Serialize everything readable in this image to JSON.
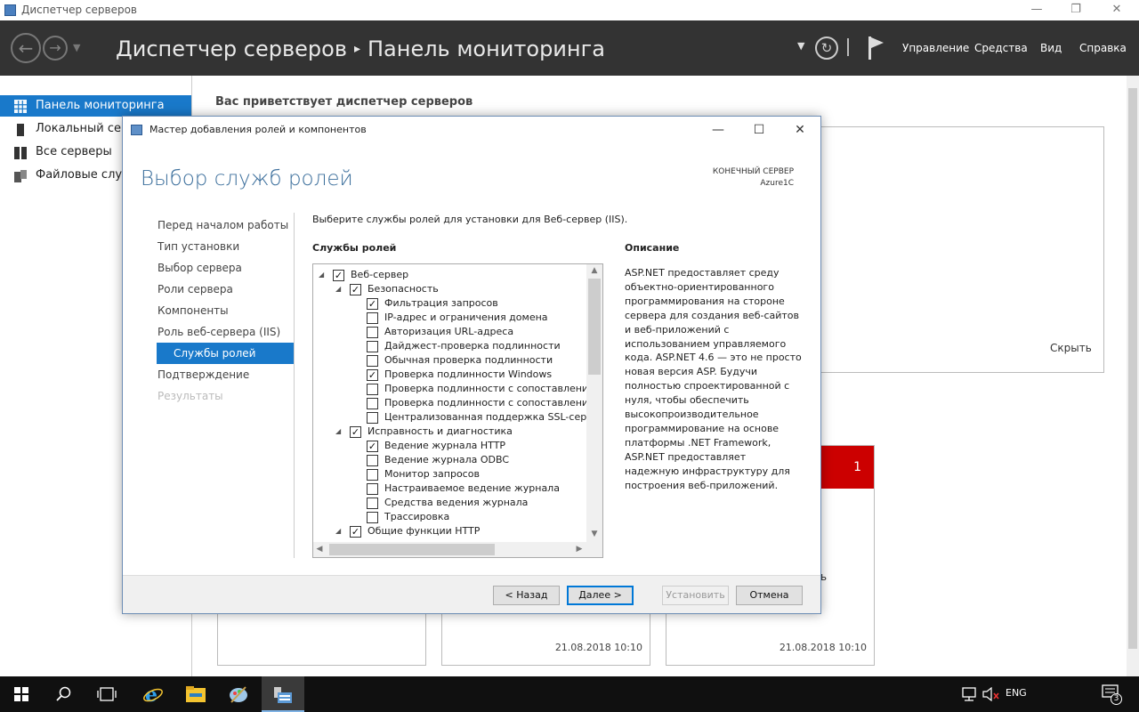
{
  "window": {
    "title": "Диспетчер серверов",
    "controls": [
      "—",
      "❐",
      "✕"
    ]
  },
  "header": {
    "breadcrumb_app": "Диспетчер серверов",
    "breadcrumb_sep": "▸",
    "breadcrumb_page": "Панель мониторинга",
    "menu": [
      "Управление",
      "Средства",
      "Вид",
      "Справка"
    ]
  },
  "sidebar": {
    "items": [
      {
        "label": "Панель мониторинга",
        "icon": "dashboard-grid-icon",
        "selected": true
      },
      {
        "label": "Локальный сервер",
        "icon": "server-icon",
        "selected": false
      },
      {
        "label": "Все серверы",
        "icon": "servers-icon",
        "selected": false
      },
      {
        "label": "Файловые службы и службы хранилища",
        "icon": "file-services-icon",
        "selected": false
      }
    ]
  },
  "main": {
    "welcome": "Вас приветствует диспетчер серверов",
    "hide_label": "Скрыть",
    "tiles": [
      {
        "timestamp": ""
      },
      {
        "timestamp": "21.08.2018 10:10"
      },
      {
        "timestamp": "21.08.2018 10:10",
        "badge": "1",
        "partial_text": "ь"
      }
    ]
  },
  "dialog": {
    "title": "Мастер добавления ролей и компонентов",
    "heading": "Выбор служб ролей",
    "target_label": "КОНЕЧНЫЙ СЕРВЕР",
    "target_value": "Azure1C",
    "steps": [
      {
        "label": "Перед началом работы",
        "state": "normal"
      },
      {
        "label": "Тип установки",
        "state": "normal"
      },
      {
        "label": "Выбор сервера",
        "state": "normal"
      },
      {
        "label": "Роли сервера",
        "state": "normal"
      },
      {
        "label": "Компоненты",
        "state": "normal"
      },
      {
        "label": "Роль веб-сервера (IIS)",
        "state": "normal"
      },
      {
        "label": "Службы ролей",
        "state": "selected"
      },
      {
        "label": "Подтверждение",
        "state": "normal"
      },
      {
        "label": "Результаты",
        "state": "disabled"
      }
    ],
    "instruction": "Выберите службы ролей для установки для Веб-сервер (IIS).",
    "services_header": "Службы ролей",
    "description_header": "Описание",
    "tree": [
      {
        "label": "Веб-сервер",
        "level": 0,
        "checked": true,
        "expandable": true
      },
      {
        "label": "Безопасность",
        "level": 1,
        "checked": true,
        "expandable": true
      },
      {
        "label": "Фильтрация запросов",
        "level": 2,
        "checked": true
      },
      {
        "label": "IP-адрес и ограничения домена",
        "level": 2,
        "checked": false
      },
      {
        "label": "Авторизация URL-адреса",
        "level": 2,
        "checked": false
      },
      {
        "label": "Дайджест-проверка подлинности",
        "level": 2,
        "checked": false
      },
      {
        "label": "Обычная проверка подлинности",
        "level": 2,
        "checked": false
      },
      {
        "label": "Проверка подлинности Windows",
        "level": 2,
        "checked": true
      },
      {
        "label": "Проверка подлинности с сопоставлением сертификата клиента",
        "level": 2,
        "checked": false
      },
      {
        "label": "Проверка подлинности с сопоставлением сертификата клиента IIS",
        "level": 2,
        "checked": false
      },
      {
        "label": "Централизованная поддержка SSL-сертификатов",
        "level": 2,
        "checked": false
      },
      {
        "label": "Исправность и диагностика",
        "level": 1,
        "checked": true,
        "expandable": true
      },
      {
        "label": "Ведение журнала HTTP",
        "level": 2,
        "checked": true
      },
      {
        "label": "Ведение журнала ODBC",
        "level": 2,
        "checked": false
      },
      {
        "label": "Монитор запросов",
        "level": 2,
        "checked": false
      },
      {
        "label": "Настраиваемое ведение журнала",
        "level": 2,
        "checked": false
      },
      {
        "label": "Средства ведения журнала",
        "level": 2,
        "checked": false
      },
      {
        "label": "Трассировка",
        "level": 2,
        "checked": false
      },
      {
        "label": "Общие функции HTTP",
        "level": 1,
        "checked": true,
        "expandable": true
      }
    ],
    "description": "ASP.NET предоставляет среду объектно-ориентированного программирования на стороне сервера для создания веб-сайтов и веб-приложений с использованием управляемого кода. ASP.NET 4.6 — это не просто новая версия ASP. Будучи полностью спроектированной с нуля, чтобы обеспечить высокопроизводительное программирование на основе платформы .NET Framework, ASP.NET предоставляет надежную инфраструктуру для построения веб-приложений.",
    "buttons": {
      "back": "< Назад",
      "next": "Далее >",
      "install": "Установить",
      "cancel": "Отмена"
    }
  },
  "taskbar": {
    "language": "ENG",
    "notification_count": "3"
  }
}
